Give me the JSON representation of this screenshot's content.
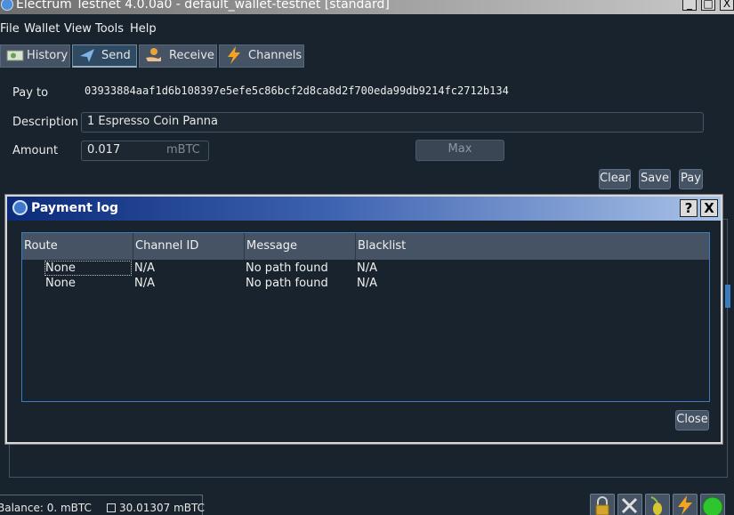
{
  "window": {
    "title": "Electrum Testnet 4.0.0a0  -  default_wallet-testnet  [standard]",
    "controls": [
      "_",
      "□",
      "X"
    ]
  },
  "menu": [
    "File",
    "Wallet",
    "View",
    "Tools",
    "Help"
  ],
  "tabs": [
    {
      "label": "History",
      "icon": "history-icon"
    },
    {
      "label": "Send",
      "icon": "send-icon"
    },
    {
      "label": "Receive",
      "icon": "receive-icon"
    },
    {
      "label": "Channels",
      "icon": "lightning-icon"
    }
  ],
  "send_form": {
    "pay_to_label": "Pay to",
    "pay_to_value": "03933884aaf1d6b108397e5efe5c86bcf2d8ca8d2f700eda99db9214fc2712b134",
    "description_label": "Description",
    "description_value": "1 Espresso Coin Panna",
    "amount_label": "Amount",
    "amount_value": "0.017",
    "amount_unit": "mBTC",
    "max_label": "Max",
    "clear_label": "Clear",
    "save_label": "Save",
    "pay_label": "Pay"
  },
  "dialog": {
    "title": "Payment log",
    "help_label": "?",
    "close_x_label": "X",
    "columns": [
      "Route",
      "Channel ID",
      "Message",
      "Blacklist"
    ],
    "rows": [
      [
        "None",
        "N/A",
        "No path found",
        "N/A"
      ],
      [
        "None",
        "N/A",
        "No path found",
        "N/A"
      ]
    ],
    "close_label": "Close"
  },
  "status": {
    "balance": "Balance: 0. mBTC",
    "lightning_balance": "30.01307 mBTC"
  },
  "status_icons": [
    "lock-icon",
    "tools-icon",
    "seed-icon",
    "lightning-icon",
    "network-status-icon"
  ],
  "colors": {
    "background": "#19232d",
    "tab": "#455364",
    "accent": "#3b7bbf",
    "network_ok": "#2ec52e"
  }
}
